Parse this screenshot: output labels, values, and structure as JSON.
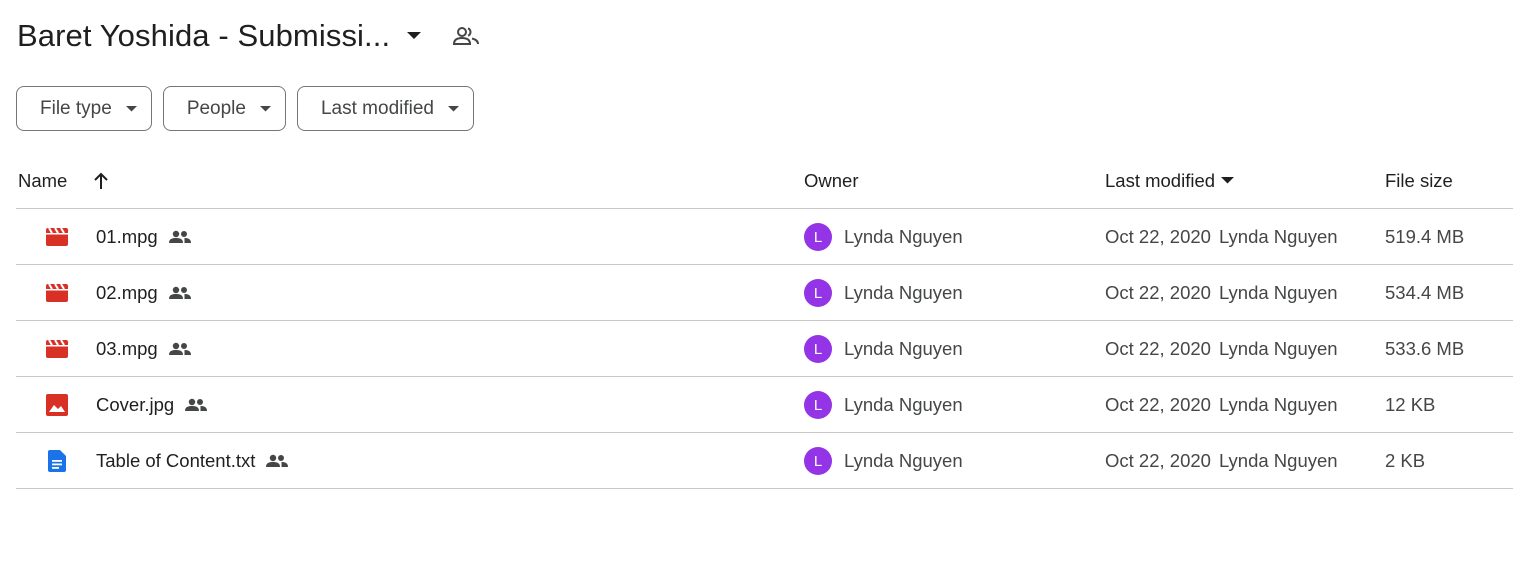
{
  "header": {
    "title": "Baret Yoshida - Submissi...",
    "title_icon": "arrow-drop-down-icon",
    "shared_icon": "shared-folder-people-icon"
  },
  "filters": [
    {
      "label": "File type"
    },
    {
      "label": "People"
    },
    {
      "label": "Last modified"
    }
  ],
  "table": {
    "columns": {
      "name": "Name",
      "owner": "Owner",
      "modified": "Last modified",
      "size": "File size"
    },
    "sort": {
      "name_arrow": "arrow-upward-icon",
      "modified_caret": "arrow-drop-down-icon"
    },
    "rows": [
      {
        "icon": "video-file-icon",
        "name": "01.mpg",
        "owner_initial": "L",
        "owner": "Lynda Nguyen",
        "modified_date": "Oct 22, 2020",
        "modified_by": "Lynda Nguyen",
        "size": "519.4 MB"
      },
      {
        "icon": "video-file-icon",
        "name": "02.mpg",
        "owner_initial": "L",
        "owner": "Lynda Nguyen",
        "modified_date": "Oct 22, 2020",
        "modified_by": "Lynda Nguyen",
        "size": "534.4 MB"
      },
      {
        "icon": "video-file-icon",
        "name": "03.mpg",
        "owner_initial": "L",
        "owner": "Lynda Nguyen",
        "modified_date": "Oct 22, 2020",
        "modified_by": "Lynda Nguyen",
        "size": "533.6 MB"
      },
      {
        "icon": "image-file-icon",
        "name": "Cover.jpg",
        "owner_initial": "L",
        "owner": "Lynda Nguyen",
        "modified_date": "Oct 22, 2020",
        "modified_by": "Lynda Nguyen",
        "size": "12 KB"
      },
      {
        "icon": "doc-file-icon",
        "name": "Table of Content.txt",
        "owner_initial": "L",
        "owner": "Lynda Nguyen",
        "modified_date": "Oct 22, 2020",
        "modified_by": "Lynda Nguyen",
        "size": "2 KB"
      }
    ]
  },
  "colors": {
    "video_icon": "#d93025",
    "image_icon": "#d93025",
    "doc_icon": "#1a73e8",
    "avatar": "#9334e6",
    "text_primary": "#1f1f1f",
    "text_secondary": "#444746",
    "divider": "#c7c7c7"
  }
}
